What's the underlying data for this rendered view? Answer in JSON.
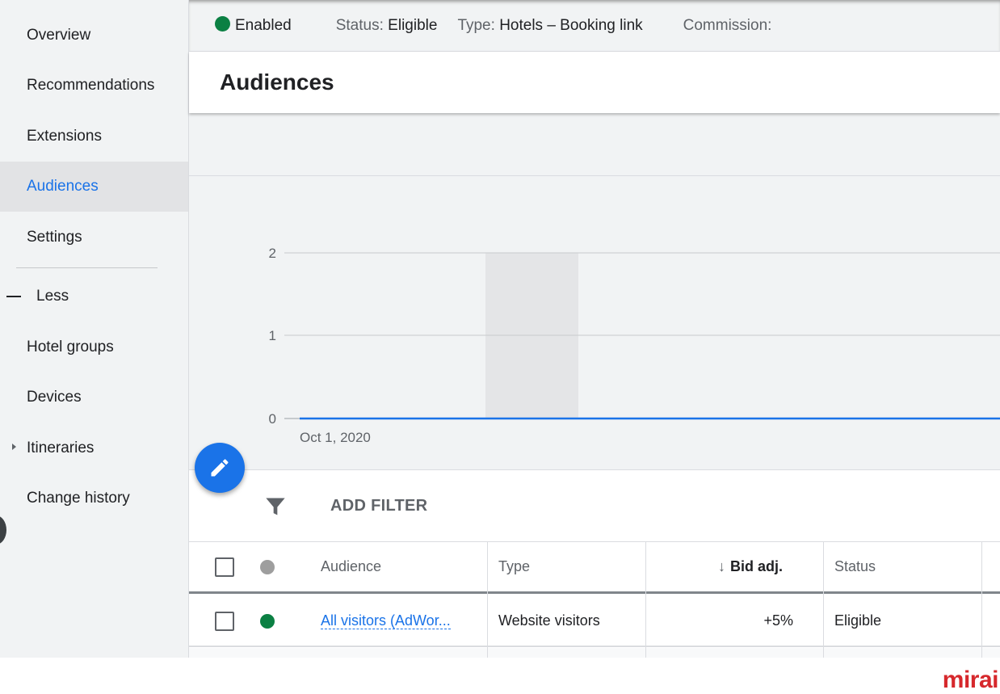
{
  "sidebar": {
    "items": [
      {
        "label": "Overview"
      },
      {
        "label": "Recommendations"
      },
      {
        "label": "Extensions"
      },
      {
        "label": "Audiences",
        "selected": true
      },
      {
        "label": "Settings"
      },
      {
        "label": "Less"
      },
      {
        "label": "Hotel groups"
      },
      {
        "label": "Devices"
      },
      {
        "label": "Itineraries"
      },
      {
        "label": "Change history"
      }
    ]
  },
  "topbar": {
    "enabled": "Enabled",
    "status_label": "Status:",
    "status_value": "Eligible",
    "type_label": "Type:",
    "type_value": "Hotels – Booking link",
    "commission_label": "Commission:"
  },
  "header": {
    "title": "Audiences"
  },
  "chart": {
    "y_ticks": [
      "2",
      "1",
      "0"
    ],
    "x_tick": "Oct 1, 2020",
    "ylim": [
      0,
      2
    ],
    "line_color": "#1a73e8"
  },
  "filter": {
    "add_filter": "ADD FILTER"
  },
  "table": {
    "columns": {
      "audience": "Audience",
      "type": "Type",
      "bid": "Bid adj.",
      "status": "Status"
    },
    "rows": [
      {
        "audience": "All visitors (AdWor...",
        "type": "Website visitors",
        "bid": "+5%",
        "status": "Eligible",
        "status_color": "#0b8043"
      }
    ]
  },
  "brand": {
    "logo": "mirai"
  }
}
